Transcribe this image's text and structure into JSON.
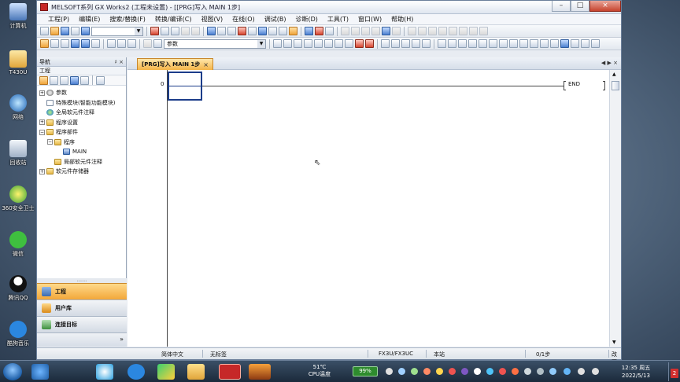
{
  "desktop": {
    "icons": [
      "计算机",
      "T430U",
      "网络",
      "回收站",
      "360安全卫士",
      "微信",
      "腾讯QQ",
      "酷狗音乐"
    ]
  },
  "window": {
    "title": "MELSOFT系列 GX Works2 (工程未设置) - [[PRG]写入 MAIN 1步]",
    "controls": {
      "minimize": "–",
      "maximize": "□",
      "close": "×"
    }
  },
  "menu": [
    "工程(P)",
    "编辑(E)",
    "搜索/替换(F)",
    "转换/编译(C)",
    "视图(V)",
    "在线(O)",
    "调试(B)",
    "诊断(D)",
    "工具(T)",
    "窗口(W)",
    "帮助(H)"
  ],
  "toolbar2": {
    "combo_value": "参数"
  },
  "navigation": {
    "title": "导航",
    "pin": "♯ ×",
    "section": "工程",
    "tree": [
      {
        "label": "参数",
        "expander": "+",
        "indent": 0,
        "icon": "gear"
      },
      {
        "label": "特殊模块(智能功能模块)",
        "expander": "",
        "indent": 0,
        "icon": "doc"
      },
      {
        "label": "全局软元件注释",
        "expander": "",
        "indent": 0,
        "icon": "globe"
      },
      {
        "label": "程序设置",
        "expander": "+",
        "indent": 0,
        "icon": "folder"
      },
      {
        "label": "程序部件",
        "expander": "−",
        "indent": 0,
        "icon": "folder"
      },
      {
        "label": "程序",
        "expander": "−",
        "indent": 1,
        "icon": "folder"
      },
      {
        "label": "MAIN",
        "expander": "",
        "indent": 3,
        "icon": "prog"
      },
      {
        "label": "局部软元件注释",
        "expander": "",
        "indent": 1,
        "icon": "folder"
      },
      {
        "label": "软元件存储器",
        "expander": "+",
        "indent": 0,
        "icon": "folder"
      }
    ],
    "tabs": [
      "工程",
      "用户库",
      "连接目标"
    ],
    "grip": "......."
  },
  "editor": {
    "tab_label": "[PRG]写入 MAIN 1步",
    "tab_close": "×",
    "tab_nav": "◀ ▶ ×",
    "step_number": "0",
    "end_instruction": "END"
  },
  "statusbar": {
    "language": "简体中文",
    "label": "无标签",
    "plc": "FX3U/FX3UC",
    "station": "本站",
    "steps": "0/1步",
    "mode": "改写"
  },
  "taskbar": {
    "cpu_temp": "51℃",
    "cpu_label": "CPU温度",
    "battery": "99%",
    "time": "12:35 周五",
    "date": "2022/5/13",
    "notifications": "2"
  }
}
